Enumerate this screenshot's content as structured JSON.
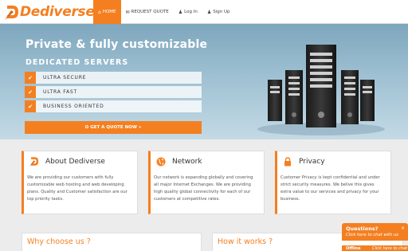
{
  "brand": {
    "name": "Dediverse",
    "accent": "#f47f20"
  },
  "nav": [
    {
      "label": "HOME",
      "icon": "home-icon",
      "glyph": "⌂"
    },
    {
      "label": "REQUEST QUOTE",
      "icon": "envelope-icon",
      "glyph": "✉"
    },
    {
      "label": "Log In",
      "icon": "user-icon",
      "glyph": "👤"
    },
    {
      "label": "Sign Up",
      "icon": "user-icon",
      "glyph": "👤"
    }
  ],
  "hero": {
    "title": "Private & fully customizable",
    "subtitle": "DEDICATED SERVERS",
    "features": [
      "ULTRA SECURE",
      "ULTRA FAST",
      "BUSINESS ORIENTED"
    ],
    "cta": "GET A QUOTE NOW »"
  },
  "cards": [
    {
      "title": "About Dediverse",
      "icon": "dediverse-logo-icon",
      "body": "We are providing our customers with fully customizable web hosting and web developing plans. Quality and Customer satisfaction are our top priority tasks."
    },
    {
      "title": "Network",
      "icon": "globe-icon",
      "body": "Our network is expanding globally and covering all major Internet Exchanges. We are providing high quality global connectivity for each of our customers at competitive rates."
    },
    {
      "title": "Privacy",
      "icon": "lock-icon",
      "body": "Customer Privacy is kept confidential and under strict security measures. We belive this gives extra value to our services and privacy for your business."
    }
  ],
  "sections": [
    {
      "title": "Why choose us ?"
    },
    {
      "title": "How it works ?"
    }
  ],
  "chat": {
    "title": "Questions?",
    "subtitle": "Click here to chat with us",
    "close": "×",
    "secondary_a": "Offline",
    "secondary_b": "Click here to chat"
  }
}
